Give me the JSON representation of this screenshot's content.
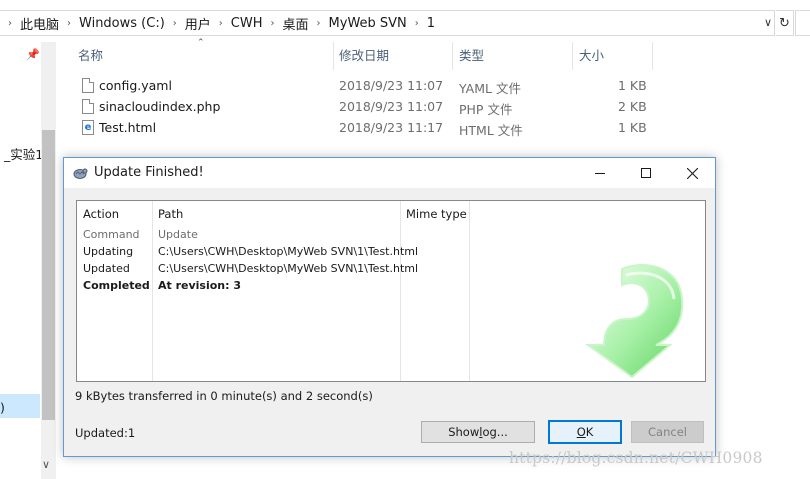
{
  "explorer": {
    "breadcrumb": [
      "此电脑",
      "Windows (C:)",
      "用户",
      "CWH",
      "桌面",
      "MyWeb SVN",
      "1"
    ],
    "columns": {
      "name": "名称",
      "modified": "修改日期",
      "type": "类型",
      "size": "大小"
    },
    "files": [
      {
        "name": "config.yaml",
        "modified": "2018/9/23 11:07",
        "type": "YAML 文件",
        "size": "1 KB",
        "icon": "file-icon"
      },
      {
        "name": "sinacloudindex.php",
        "modified": "2018/9/23 11:07",
        "type": "PHP 文件",
        "size": "2 KB",
        "icon": "file-icon"
      },
      {
        "name": "Test.html",
        "modified": "2018/9/23 11:17",
        "type": "HTML 文件",
        "size": "1 KB",
        "icon": "html-file-icon"
      }
    ],
    "nav_partial_text": "_实验1",
    "nav_partial_text2": ")"
  },
  "dialog": {
    "title": "Update Finished!",
    "log_headers": {
      "action": "Action",
      "path": "Path",
      "mime": "Mime type"
    },
    "log_rows": [
      {
        "action": "Command",
        "path": "Update",
        "style": "cmd"
      },
      {
        "action": "Updating",
        "path": "C:\\Users\\CWH\\Desktop\\MyWeb SVN\\1\\Test.html",
        "style": "normal"
      },
      {
        "action": "Updated",
        "path": "C:\\Users\\CWH\\Desktop\\MyWeb SVN\\1\\Test.html",
        "style": "normal"
      },
      {
        "action": "Completed",
        "path": "At revision: 3",
        "style": "bold"
      }
    ],
    "transfer_status": "9 kBytes transferred in 0 minute(s) and 2 second(s)",
    "updated_count": "Updated:1",
    "buttons": {
      "show_log_pre": "Show ",
      "show_log_ul": "l",
      "show_log_post": "og...",
      "ok_ul": "O",
      "ok_post": "K",
      "cancel": "Cancel"
    }
  },
  "watermark": "https://blog.csdn.net/CWH0908",
  "colors": {
    "accent": "#0078d7",
    "header_text": "#4c607a",
    "arrow_green": "#7ee07e"
  }
}
